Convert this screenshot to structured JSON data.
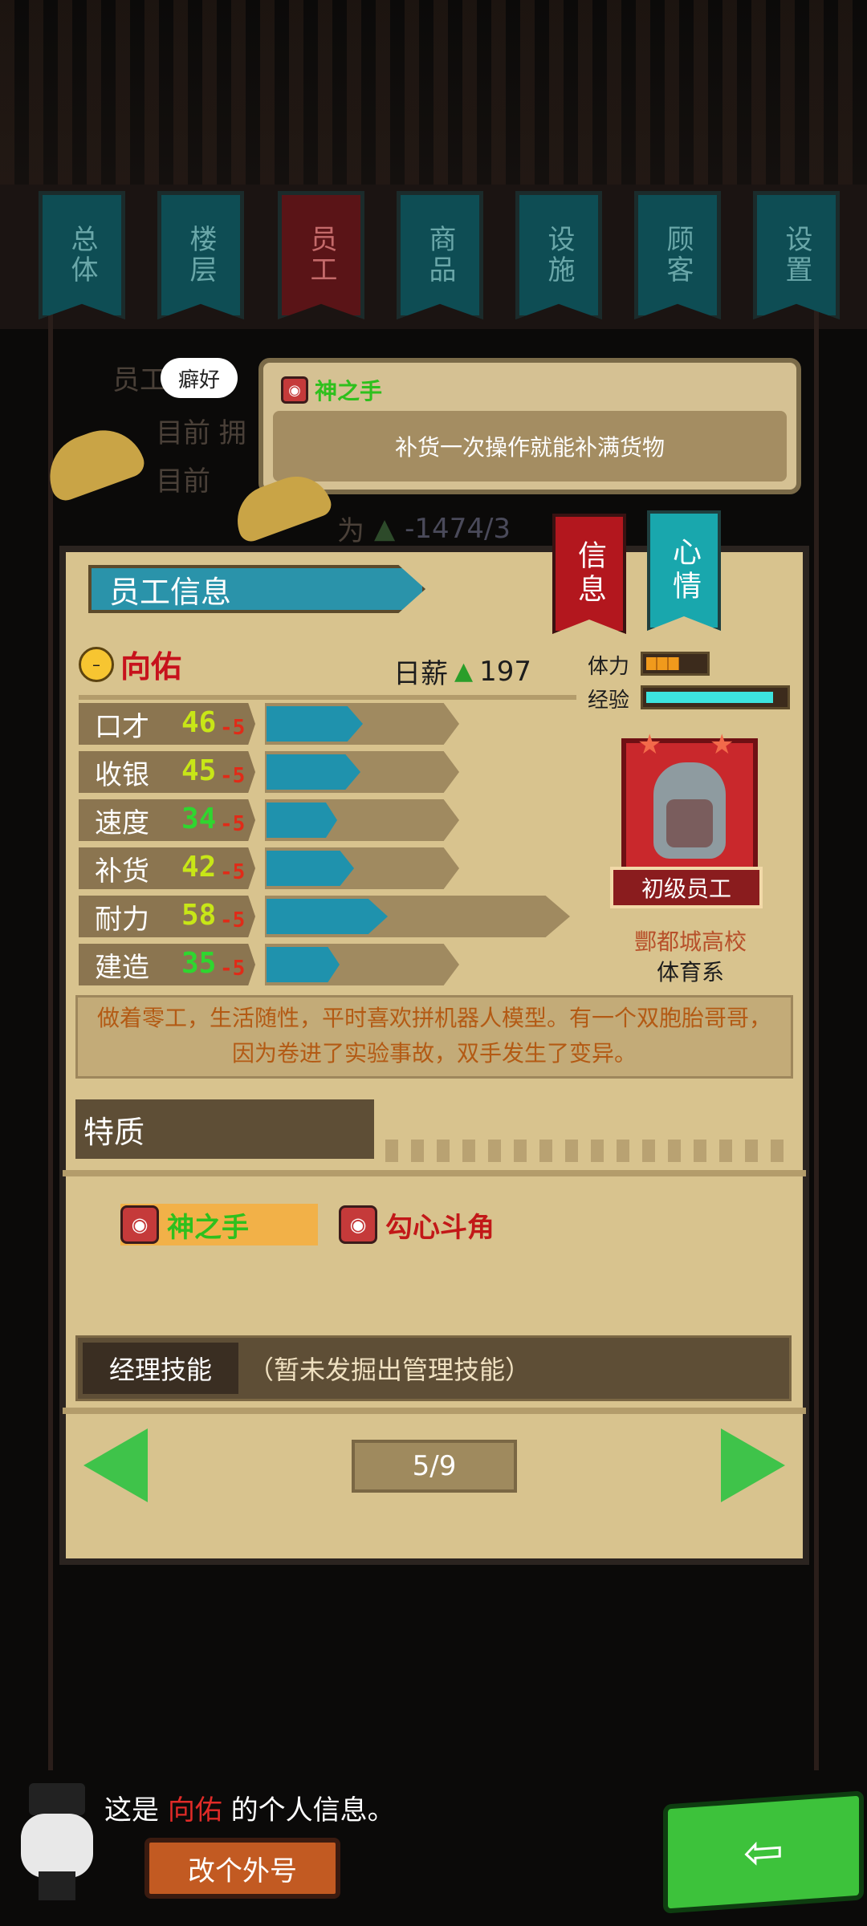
{
  "top_tabs": [
    "总体",
    "楼层",
    "员工",
    "商品",
    "设施",
    "顾客",
    "设置"
  ],
  "active_tab_index": 2,
  "background_text": {
    "row1": "员工",
    "row2": "目前 拥",
    "row3": "目前 ",
    "row4_suffix": "为",
    "row4_money": "-1474/3",
    "row4_money_icon": "money-icon"
  },
  "hobby_bubble": "癖好",
  "tooltip": {
    "title": "神之手",
    "text": "补货一次操作就能补满货物"
  },
  "panel": {
    "title": "员工信息",
    "tab_info": "信息",
    "tab_mood": "心情"
  },
  "employee": {
    "name": "向佑",
    "salary_label": "日薪",
    "salary": "197",
    "stamina_label": "体力",
    "stamina_level": 0.55,
    "exp_label": "经验",
    "exp_level": 0.92,
    "rank": "初级员工",
    "school": "酆都城高校",
    "department": "体育系",
    "description": "做着零工，生活随性，平时喜欢拼机器人模型。有一个双胞胎哥哥，因为卷进了实验事故，双手发生了变异。"
  },
  "stats": [
    {
      "label": "口才",
      "value": "46",
      "penalty": "-5",
      "color": "#c8e617",
      "fill": 0.46
    },
    {
      "label": "收银",
      "value": "45",
      "penalty": "-5",
      "color": "#c8e617",
      "fill": 0.45
    },
    {
      "label": "速度",
      "value": "34",
      "penalty": "-5",
      "color": "#2fd62f",
      "fill": 0.34
    },
    {
      "label": "补货",
      "value": "42",
      "penalty": "-5",
      "color": "#c8e617",
      "fill": 0.42
    },
    {
      "label": "耐力",
      "value": "58",
      "penalty": "-5",
      "color": "#c8e617",
      "fill": 0.58
    },
    {
      "label": "建造",
      "value": "35",
      "penalty": "-5",
      "color": "#2fd62f",
      "fill": 0.35
    }
  ],
  "traits_section": {
    "title": "特质",
    "items": [
      "神之手",
      "勾心斗角"
    ]
  },
  "manager_skill": {
    "label": "经理技能",
    "value": "（暂未发掘出管理技能）"
  },
  "pagination": {
    "text": "5/9"
  },
  "footer": {
    "caption_prefix": "这是",
    "caption_name": "向佑",
    "caption_suffix": "的个人信息。",
    "nickname_button": "改个外号",
    "back_icon": "back-arrow-icon"
  }
}
